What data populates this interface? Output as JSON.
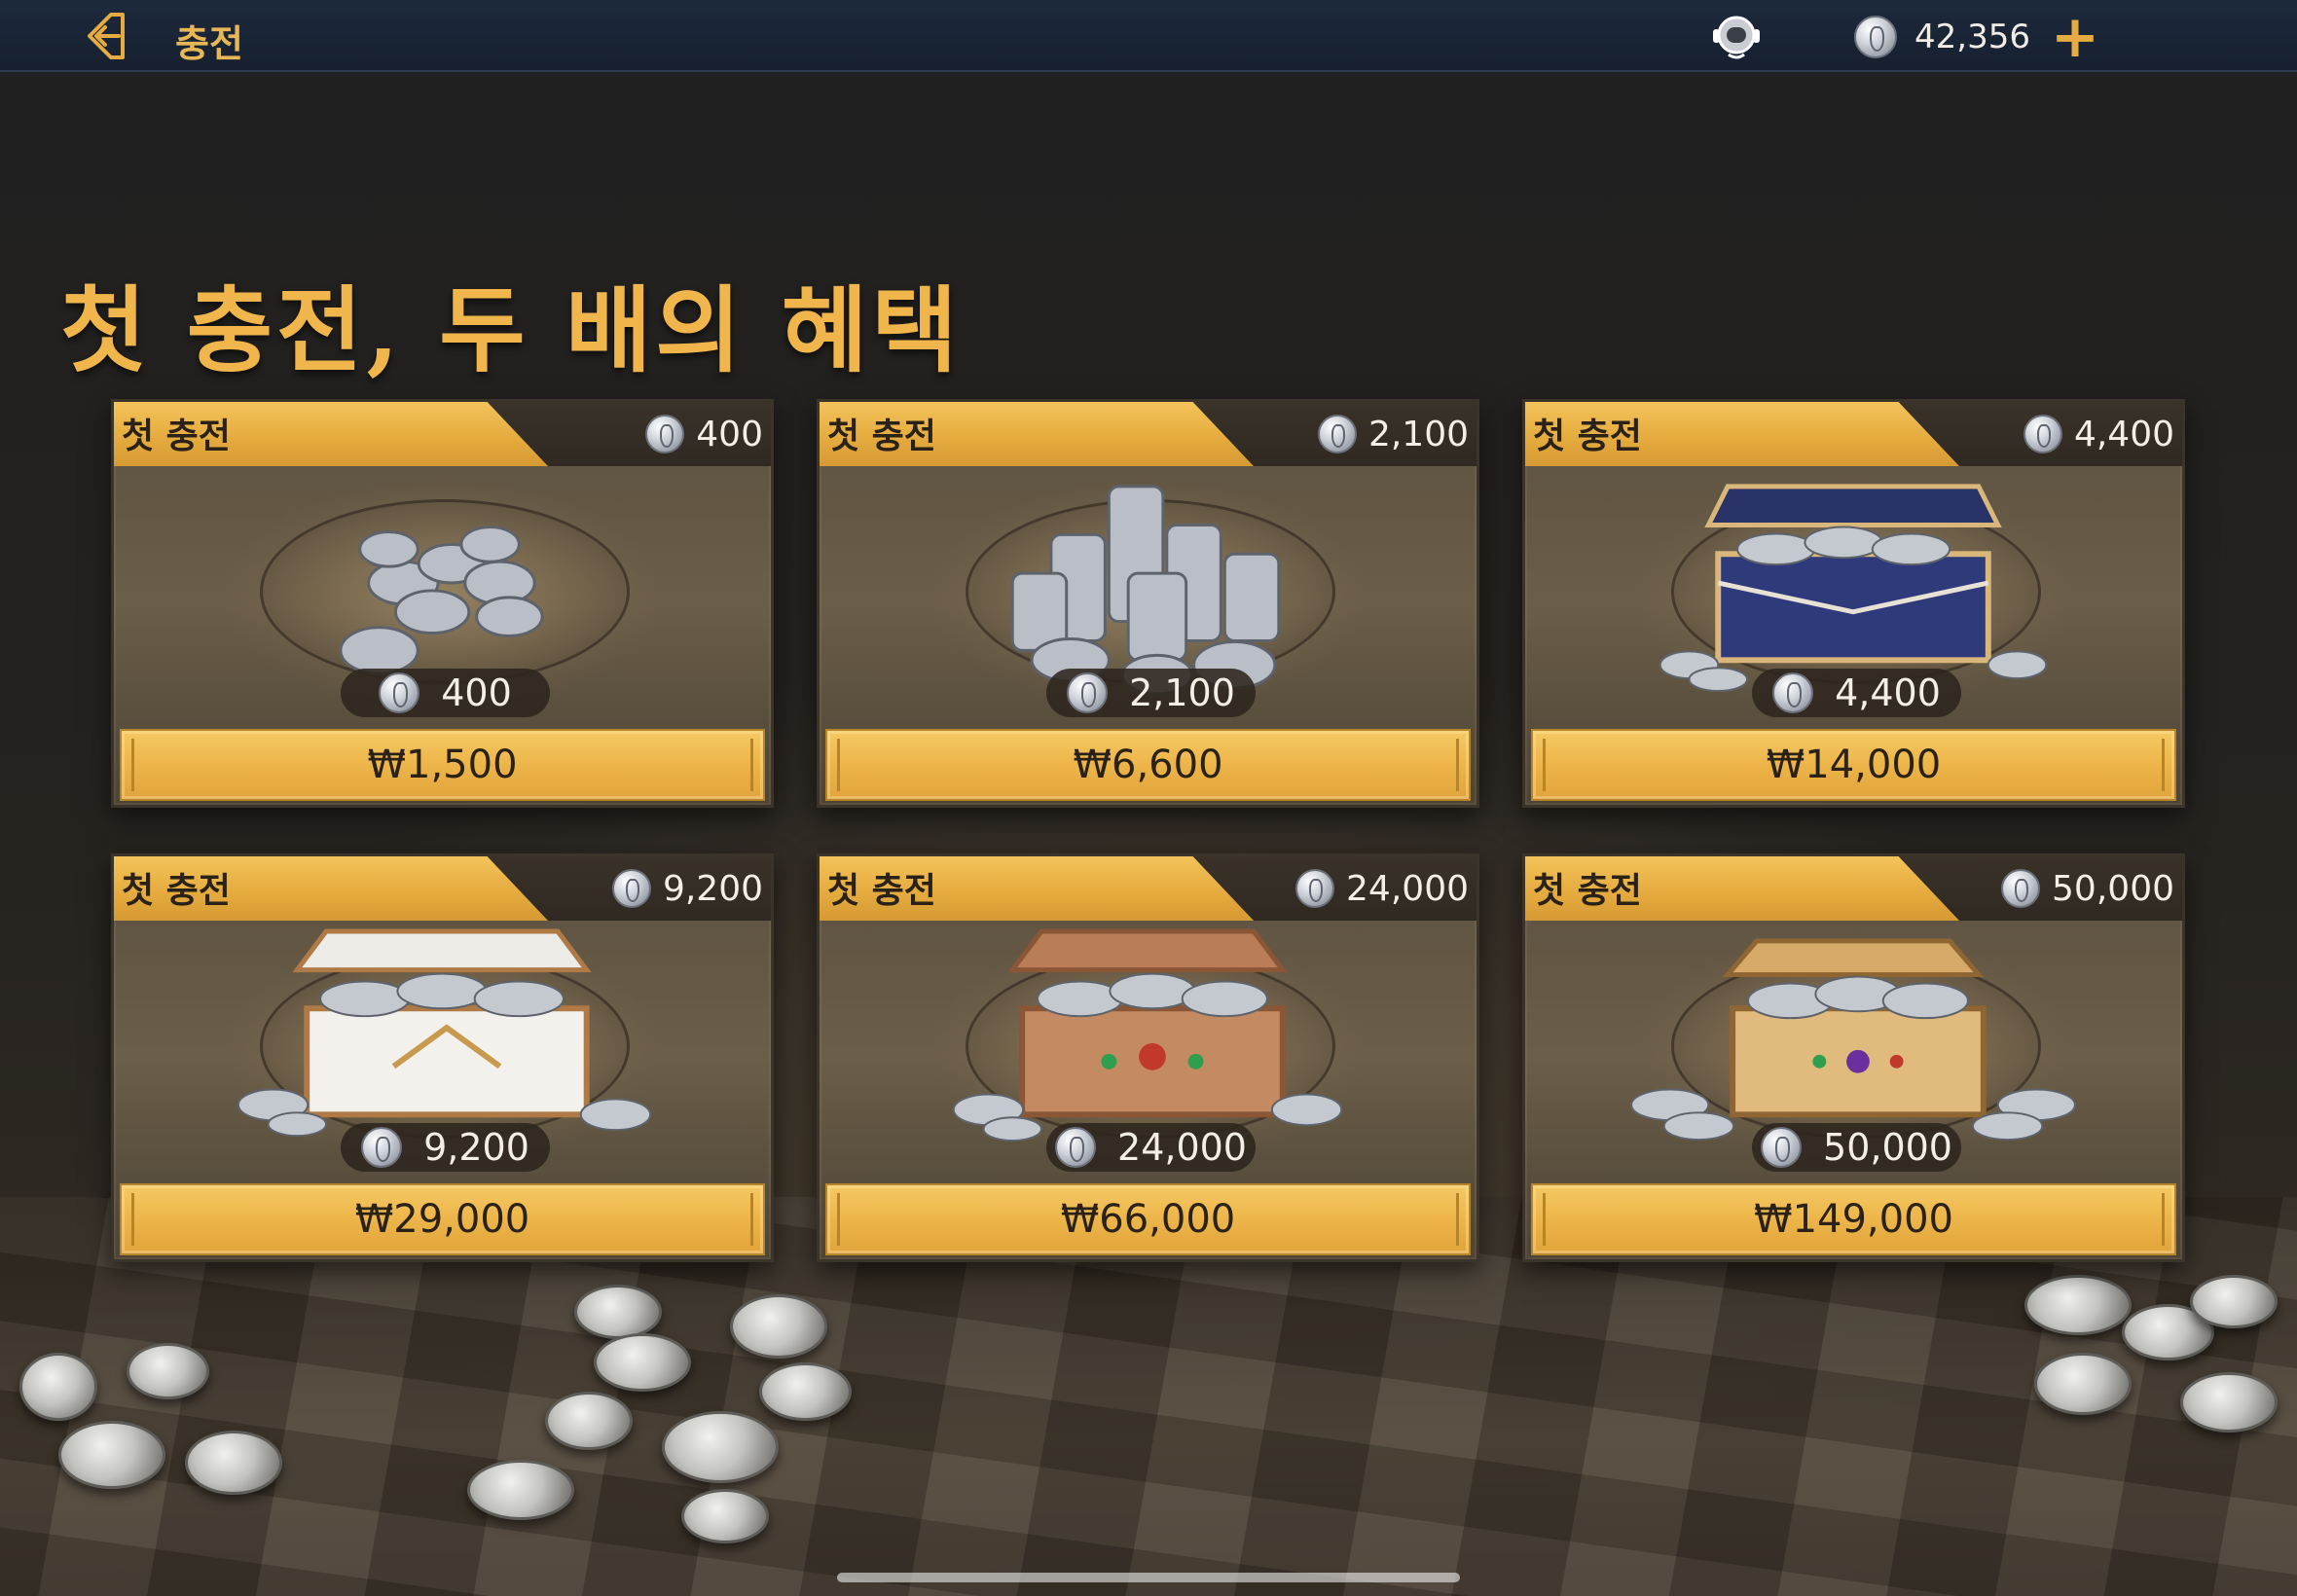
{
  "topbar": {
    "title": "충전",
    "back_icon": "back-arrow-icon",
    "support_icon": "headset-icon",
    "currency_icon": "silver-coin-icon",
    "balance": "42,356",
    "add_icon": "plus-icon",
    "plus_label": "+"
  },
  "headline": "첫 충전, 두 배의 혜택",
  "colors": {
    "accent_gold": "#e9b655",
    "topbar": "#1d2a3d",
    "button_gold": "#edb549"
  },
  "products": [
    {
      "badge": "첫 충전",
      "bonus_amount": "400",
      "amount": "400",
      "price": "₩1,500",
      "art": "small-coin-pile"
    },
    {
      "badge": "첫 충전",
      "bonus_amount": "2,100",
      "amount": "2,100",
      "price": "₩6,600",
      "art": "coin-stacks"
    },
    {
      "badge": "첫 충전",
      "bonus_amount": "4,400",
      "amount": "4,400",
      "price": "₩14,000",
      "art": "blue-chest"
    },
    {
      "badge": "첫 충전",
      "bonus_amount": "9,200",
      "amount": "9,200",
      "price": "₩29,000",
      "art": "white-chest"
    },
    {
      "badge": "첫 충전",
      "bonus_amount": "24,000",
      "amount": "24,000",
      "price": "₩66,000",
      "art": "bronze-chest"
    },
    {
      "badge": "첫 충전",
      "bonus_amount": "50,000",
      "amount": "50,000",
      "price": "₩149,000",
      "art": "gold-chest"
    }
  ]
}
